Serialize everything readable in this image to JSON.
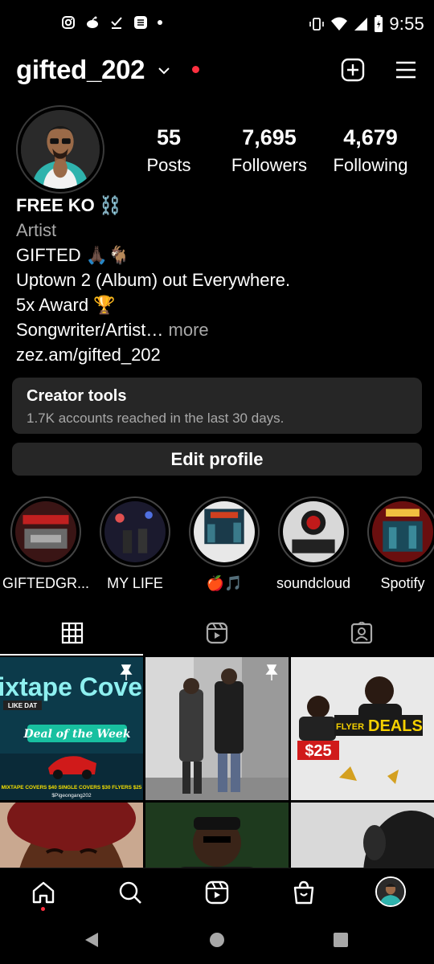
{
  "status_bar": {
    "time": "9:55",
    "left_icons": [
      "instagram-icon",
      "reddit-icon",
      "download-done-icon",
      "app-icon",
      "dot-icon"
    ],
    "right_icons": [
      "vibrate-icon",
      "wifi-icon",
      "signal-icon",
      "battery-icon"
    ]
  },
  "header": {
    "username": "gifted_202",
    "has_live_dot": true,
    "accent_color": "#ff3040"
  },
  "profile": {
    "stats": [
      {
        "value": "55",
        "label": "Posts"
      },
      {
        "value": "7,695",
        "label": "Followers"
      },
      {
        "value": "4,679",
        "label": "Following"
      }
    ],
    "bio": {
      "name": "FREE KO ⛓️",
      "category": "Artist",
      "lines": [
        "GIFTED 🙏🏿🐐",
        "Uptown 2 (Album) out Everywhere.",
        "5x Award 🏆"
      ],
      "truncated_line": "Songwriter/Artist…",
      "more_label": "more",
      "link": "zez.am/gifted_202"
    }
  },
  "creator_tools": {
    "title": "Creator tools",
    "subtitle": "1.7K accounts reached in the last 30 days."
  },
  "edit_profile_label": "Edit profile",
  "highlights": [
    {
      "label": "GIFTEDGR..."
    },
    {
      "label": "MY LIFE"
    },
    {
      "label": "🍎🎵"
    },
    {
      "label": "soundcloud"
    },
    {
      "label": "Spotify"
    }
  ],
  "tabs": [
    {
      "name": "grid",
      "icon": "grid-icon",
      "active": true
    },
    {
      "name": "reels",
      "icon": "reels-icon",
      "active": false
    },
    {
      "name": "tagged",
      "icon": "tagged-icon",
      "active": false
    }
  ],
  "posts": [
    {
      "kind": "mixtape",
      "title": "Mixtape Covers",
      "banner": "Deal of the Week",
      "badge": "LIKE DAT",
      "footer": "MIXTAPE COVERS $40 SINGLE COVERS $30 FLYERS $25",
      "handle": "$Pigeongang202"
    },
    {
      "kind": "photo-street"
    },
    {
      "kind": "flyer",
      "price": "$25",
      "flyer_label": "FLYER",
      "deals_label": "DEALS"
    },
    {
      "kind": "photo-face"
    },
    {
      "kind": "photo-man"
    },
    {
      "kind": "photo-dark"
    }
  ],
  "bottom_nav": [
    "home-icon",
    "search-icon",
    "reels-icon",
    "shop-icon",
    "profile-avatar"
  ],
  "system_nav": [
    "back-icon",
    "home-circle-icon",
    "recents-icon"
  ]
}
